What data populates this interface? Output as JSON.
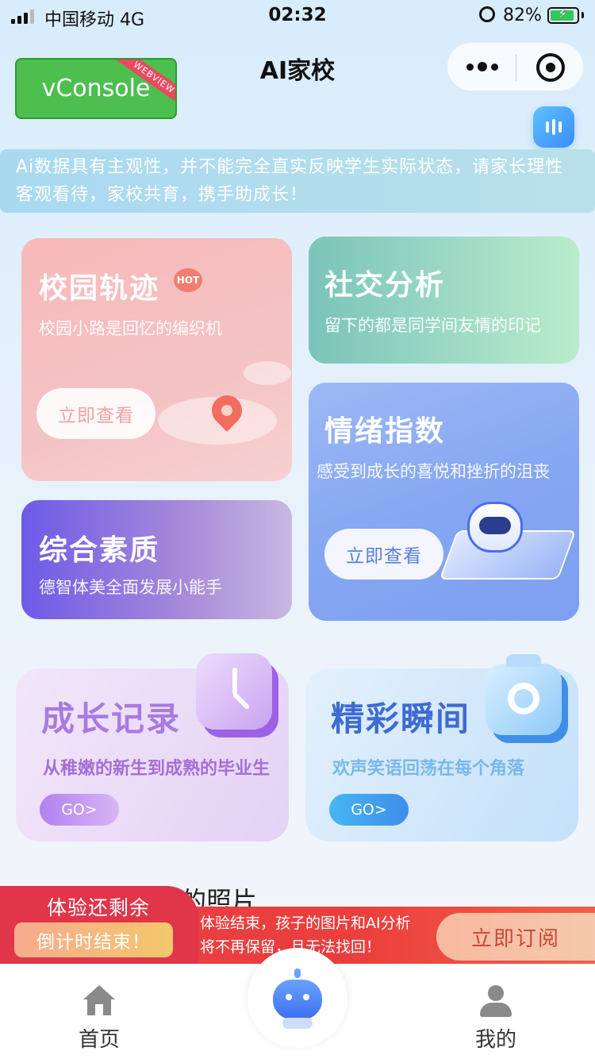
{
  "status_bar": {
    "carrier": "中国移动  4G",
    "time": "02:32",
    "battery_percent": "82%",
    "battery_level": 0.82,
    "battery_color": "#34c759"
  },
  "nav": {
    "title": "AI家校",
    "vconsole_label": "vConsole",
    "vconsole_ribbon": "WEBVIEW",
    "more_icon": "more-dots-icon",
    "close_icon": "target-circle-icon"
  },
  "notice": "Ai数据具有主观性，并不能完全直实反映学生实际状态，请家长理性客观看待，家校共育，携手助成长！",
  "cards": {
    "campus": {
      "title": "校园轨迹",
      "badge": "HOT",
      "subtitle": "校园小路是回忆的编织机",
      "button": "立即查看"
    },
    "social": {
      "title": "社交分析",
      "subtitle": "留下的都是同学间友情的印记"
    },
    "quality": {
      "title": "综合素质",
      "subtitle": "德智体美全面发展小能手"
    },
    "emotion": {
      "title": "情绪指数",
      "subtitle": "感受到成长的喜悦和挫折的沮丧",
      "button": "立即查看"
    },
    "growth": {
      "title": "成长记录",
      "subtitle": "从稚嫩的新生到成熟的毕业生",
      "button": "GO>"
    },
    "moment": {
      "title": "精彩瞬间",
      "subtitle": "欢声笑语回荡在每个角落",
      "button": "GO>"
    }
  },
  "section_heading": "的照片",
  "trial": {
    "remaining_label": "体验还剩余",
    "countdown": "倒计时结束！",
    "message": "体验结束，孩子的图片和AI分析将不再保留，且无法找回！",
    "subscribe": "立即订阅"
  },
  "tabbar": {
    "home": "首页",
    "mine": "我的"
  },
  "colors": {
    "accent": "#3e6ad4",
    "trial_red": "#e93e45"
  }
}
